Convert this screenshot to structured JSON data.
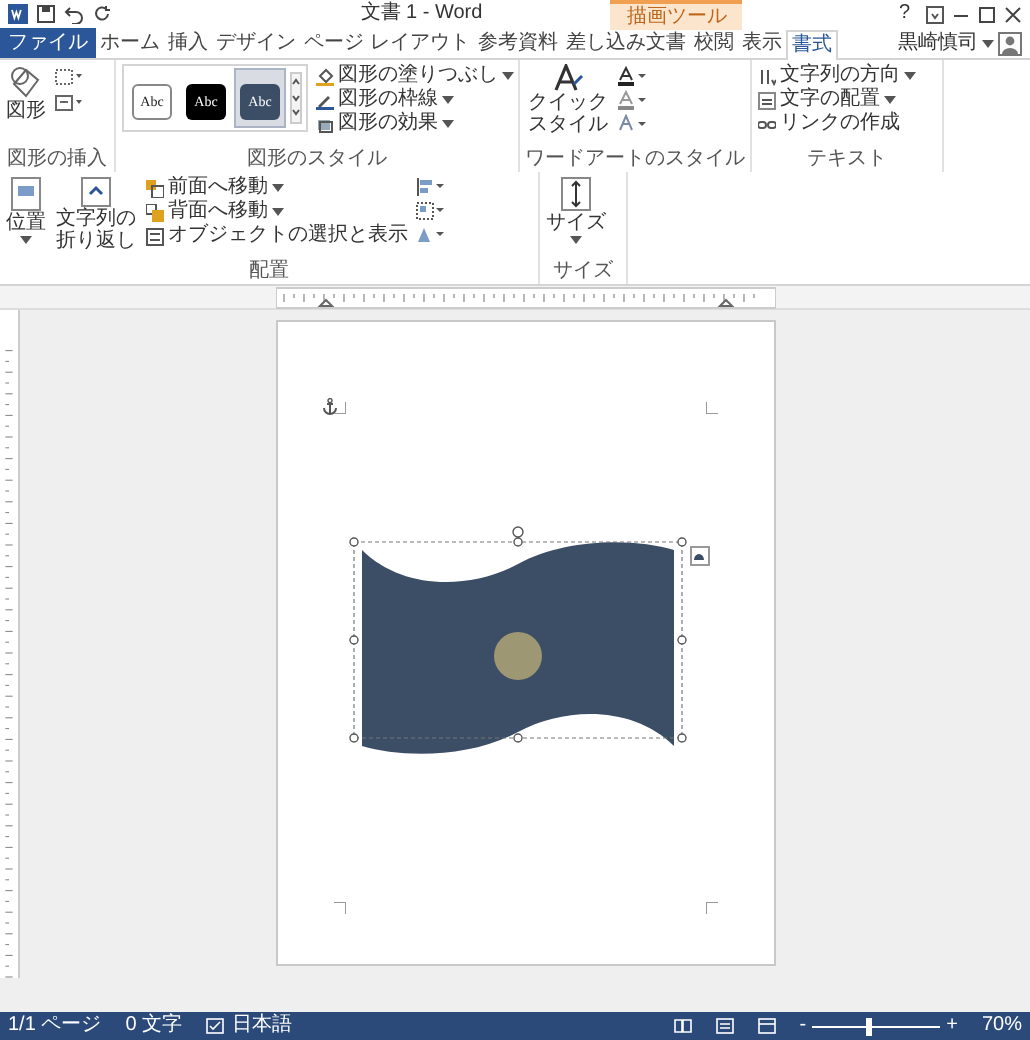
{
  "title_bar": {
    "title": "文書 1 - Word",
    "context_label": "描画ツール",
    "help": "?"
  },
  "file_button": {
    "label": "ファイル"
  },
  "tabs": [
    {
      "label": "ホーム",
      "selected": false
    },
    {
      "label": "挿入",
      "selected": false
    },
    {
      "label": "デザイン",
      "selected": false
    },
    {
      "label": "ページ レイアウト",
      "selected": false
    },
    {
      "label": "参考資料",
      "selected": false
    },
    {
      "label": "差し込み文書",
      "selected": false
    },
    {
      "label": "校閲",
      "selected": false
    },
    {
      "label": "表示",
      "selected": false
    },
    {
      "label": "書式",
      "selected": true
    }
  ],
  "user": {
    "name": "黒崎慎司"
  },
  "insert_group": {
    "label": "図形の挿入",
    "button": "図形"
  },
  "style_group": {
    "label": "図形のスタイル",
    "presets": [
      {
        "text": "Abc",
        "kind": "outline",
        "selected": false
      },
      {
        "text": "Abc",
        "kind": "black",
        "selected": false
      },
      {
        "text": "Abc",
        "kind": "dark",
        "selected": true
      }
    ],
    "commands": [
      {
        "label": "図形の塗りつぶし",
        "dropdown": true
      },
      {
        "label": "図形の枠線",
        "dropdown": true
      },
      {
        "label": "図形の効果",
        "dropdown": true
      }
    ]
  },
  "wordart_group": {
    "label": "ワードアートのスタイル",
    "quick_style": "クイックスタイル"
  },
  "text_group": {
    "label": "テキスト",
    "commands": [
      {
        "label": "文字列の方向",
        "dropdown": true
      },
      {
        "label": "文字の配置",
        "dropdown": true
      },
      {
        "label": "リンクの作成",
        "dropdown": false
      }
    ]
  },
  "arrange_group": {
    "label": "配置",
    "position": "位置",
    "wrap": "文字列の折り返し",
    "commands": [
      {
        "label": "前面へ移動",
        "dropdown": true
      },
      {
        "label": "背面へ移動",
        "dropdown": true
      },
      {
        "label": "オブジェクトの選択と表示",
        "dropdown": false
      }
    ]
  },
  "size_group": {
    "label": "サイズ",
    "button": "サイズ"
  },
  "status_bar": {
    "page": "1/1 ページ",
    "words": "0 文字",
    "language": "日本語",
    "zoom": "70%",
    "zoom_out": "-",
    "zoom_in": "+",
    "zoom_slider": {
      "level": 0.45
    }
  }
}
